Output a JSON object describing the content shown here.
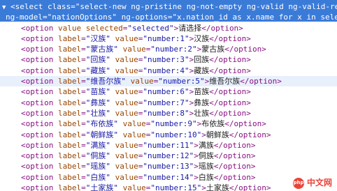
{
  "select_open": {
    "line1": {
      "open": "<select",
      "class_attr": "class",
      "class_val": "\"select-new ng-pristine ng-not-empty ng-valid ng-valid-re"
    },
    "line2": {
      "model_attr": "ng-model",
      "model_val": "\"nationOptions\"",
      "options_attr": "ng-options",
      "options_val": "\"x.nation_id as x.name for x in selec"
    }
  },
  "first_option": {
    "open": "<option",
    "value_attr": "value",
    "selected_attr": "selected",
    "selected_val": "\"selected\"",
    "text": "请选择",
    "close": "</option>"
  },
  "options": [
    {
      "label": "\"汉族\"",
      "value": "\"number:1\"",
      "text": "汉族"
    },
    {
      "label": "\"蒙古族\"",
      "value": "\"number:2\"",
      "text": "蒙古族"
    },
    {
      "label": "\"回族\"",
      "value": "\"number:3\"",
      "text": "回族"
    },
    {
      "label": "\"藏族\"",
      "value": "\"number:4\"",
      "text": "藏族"
    },
    {
      "label": "\"维吾尔族\"",
      "value": "\"number:5\"",
      "text": "维吾尔族"
    },
    {
      "label": "\"苗族\"",
      "value": "\"number:6\"",
      "text": "苗族"
    },
    {
      "label": "\"彝族\"",
      "value": "\"number:7\"",
      "text": "彝族"
    },
    {
      "label": "\"壮族\"",
      "value": "\"number:8\"",
      "text": "壮族"
    },
    {
      "label": "\"布依族\"",
      "value": "\"number:9\"",
      "text": "布依族"
    },
    {
      "label": "\"朝鲜族\"",
      "value": "\"number:10\"",
      "text": "朝鲜族"
    },
    {
      "label": "\"满族\"",
      "value": "\"number:11\"",
      "text": "满族"
    },
    {
      "label": "\"侗族\"",
      "value": "\"number:12\"",
      "text": "侗族"
    },
    {
      "label": "\"瑶族\"",
      "value": "\"number:13\"",
      "text": "瑶族"
    },
    {
      "label": "\"白族\"",
      "value": "\"number:14\"",
      "text": "白族"
    },
    {
      "label": "\"土家族\"",
      "value": "\"number:15\"",
      "text": "土家族"
    }
  ],
  "syntax": {
    "open": "<option",
    "label_attr": "label",
    "value_attr": "value",
    "close": "</option>",
    "equals": "=",
    "gt": ">",
    "triangle": "▼"
  },
  "watermark": {
    "logo_text": "php",
    "site_text": "中文网"
  },
  "colors": {
    "selection_bg": "#3b7bd8",
    "hover_bg": "#e8f0fc",
    "tag": "#881280",
    "attr": "#994500",
    "value": "#1a1aa6"
  }
}
